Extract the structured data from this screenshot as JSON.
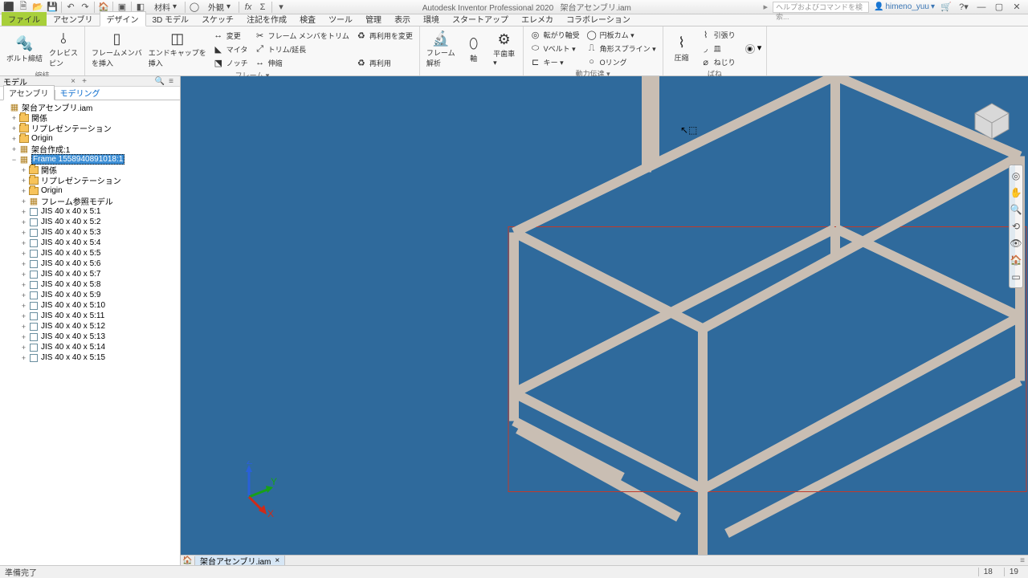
{
  "titlebar": {
    "app": "Autodesk Inventor Professional 2020",
    "doc": "架台アセンブリ.iam",
    "search_placeholder": "ヘルプおよびコマンドを検索...",
    "user": "himeno_yuu",
    "material_dd": "材料",
    "ext_dd": "外観"
  },
  "ribbon_tabs": [
    "ファイル",
    "アセンブリ",
    "デザイン",
    "3D モデル",
    "スケッチ",
    "注記を作成",
    "検査",
    "ツール",
    "管理",
    "表示",
    "環境",
    "スタートアップ",
    "エレメカ",
    "コラボレーション"
  ],
  "ribbon_active": 2,
  "ribbon": {
    "panel1": {
      "label": "縮結",
      "b1": "ボルト締結",
      "b2": "クレビス\nピン"
    },
    "panel2": {
      "label": "フレーム ▾",
      "b1": "フレームメンバ\nを挿入",
      "b2": "エンドキャップを\n挿入",
      "r": [
        "変更",
        "マイタ",
        "ノッチ",
        "フレーム メンバをトリム",
        "トリム/延長",
        "伸縮",
        "再利用を変更",
        "",
        "再利用"
      ]
    },
    "panel3": {
      "label": "",
      "btns": [
        "フレーム\n解析",
        "軸",
        "平歯車\n▾"
      ]
    },
    "panel4": {
      "label": "動力伝達 ▾",
      "r": [
        "転がり軸受",
        "Vベルト ▾",
        "キー ▾",
        "円板カム ▾",
        "角形スプライン ▾",
        "Oリング"
      ]
    },
    "panel5": {
      "label": "ばね",
      "b": "圧縮",
      "r": [
        "引張り",
        "皿",
        "ねじり"
      ]
    }
  },
  "leftpanel": {
    "title": "モデル",
    "tabs": [
      "アセンブリ",
      "モデリング"
    ]
  },
  "tree": {
    "root": "架台アセンブリ.iam",
    "relations": "関係",
    "repr": "リプレゼンテーション",
    "origin": "Origin",
    "framegen": "架台作成:1",
    "frame": "Frame 1558940891018:1",
    "frame_children_top": [
      "関係",
      "リプレゼンテーション",
      "Origin",
      "フレーム参照モデル"
    ],
    "members": [
      "JIS 40 x 40 x 5:1",
      "JIS 40 x 40 x 5:2",
      "JIS 40 x 40 x 5:3",
      "JIS 40 x 40 x 5:4",
      "JIS 40 x 40 x 5:5",
      "JIS 40 x 40 x 5:6",
      "JIS 40 x 40 x 5:7",
      "JIS 40 x 40 x 5:8",
      "JIS 40 x 40 x 5:9",
      "JIS 40 x 40 x 5:10",
      "JIS 40 x 40 x 5:11",
      "JIS 40 x 40 x 5:12",
      "JIS 40 x 40 x 5:13",
      "JIS 40 x 40 x 5:14",
      "JIS 40 x 40 x 5:15"
    ]
  },
  "doctab": "架台アセンブリ.iam",
  "status": {
    "left": "準備完了",
    "n1": "18",
    "n2": "19"
  },
  "triad": {
    "x": "X",
    "y": "Y",
    "z": "Z"
  }
}
